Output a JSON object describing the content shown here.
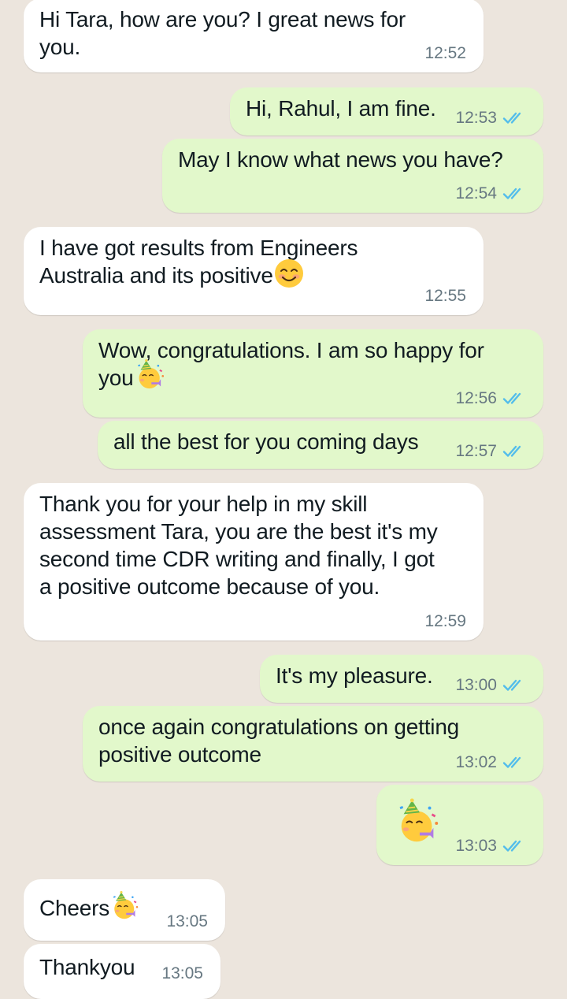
{
  "colors": {
    "background": "#ECE5DD",
    "incoming_bubble": "#ffffff",
    "outgoing_bubble": "#E2F8CB",
    "timestamp": "#667781",
    "read_ticks": "#53BDEB"
  },
  "messages": [
    {
      "direction": "incoming",
      "text": "Hi Tara, how are you? I great news for\nyou.",
      "time": "12:52"
    },
    {
      "direction": "outgoing",
      "text": "Hi, Rahul, I am fine.",
      "time": "12:53",
      "status": "read"
    },
    {
      "direction": "outgoing",
      "text": "May I know what news you have?",
      "time": "12:54",
      "status": "read"
    },
    {
      "direction": "incoming",
      "text": "I have got results from Engineers\nAustralia and its positive",
      "emoji": "smiling-face-icon",
      "time": "12:55"
    },
    {
      "direction": "outgoing",
      "text": "Wow, congratulations. I am so happy for\nyou",
      "emoji": "partying-face-icon",
      "time": "12:56",
      "status": "read"
    },
    {
      "direction": "outgoing",
      "text": "all the best for you coming days",
      "time": "12:57",
      "status": "read"
    },
    {
      "direction": "incoming",
      "text": "Thank you for your help in my skill\nassessment Tara, you are the best it's my\nsecond time CDR writing and finally, I got\na positive outcome because of you.",
      "time": "12:59"
    },
    {
      "direction": "outgoing",
      "text": "It's my pleasure.",
      "time": "13:00",
      "status": "read"
    },
    {
      "direction": "outgoing",
      "text": "once again congratulations on getting\npositive outcome",
      "time": "13:02",
      "status": "read"
    },
    {
      "direction": "outgoing",
      "text": "",
      "emoji": "partying-face-icon",
      "time": "13:03",
      "status": "read"
    },
    {
      "direction": "incoming",
      "text": "Cheers",
      "emoji": "partying-face-icon",
      "time": "13:05"
    },
    {
      "direction": "incoming",
      "text": "Thankyou",
      "time": "13:05"
    }
  ]
}
